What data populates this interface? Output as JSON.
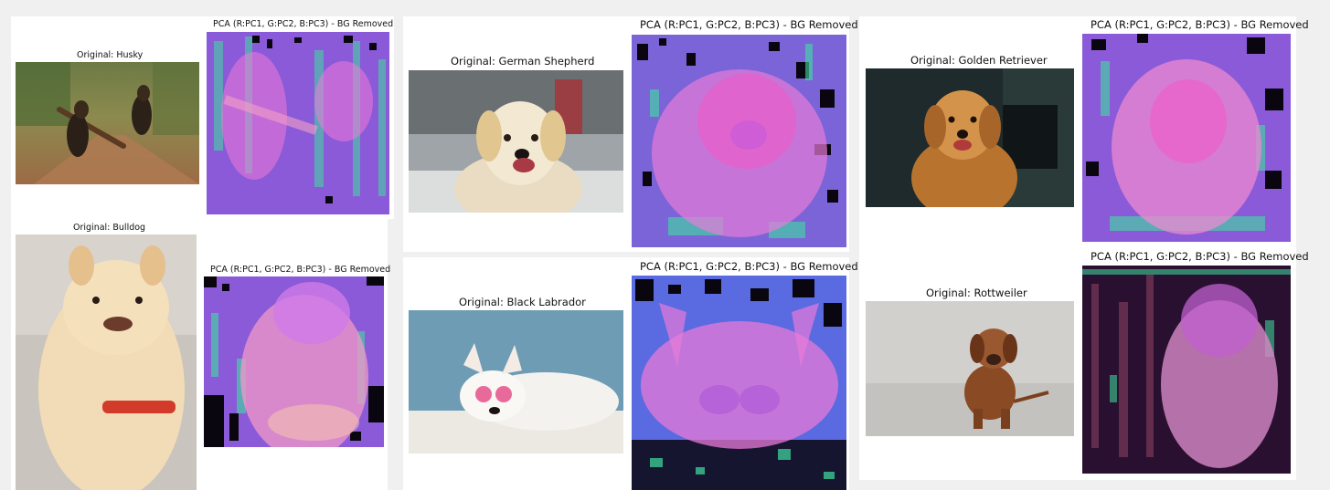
{
  "figures": [
    {
      "original_title": "Original: Husky",
      "pca_title": "PCA (R:PC1, G:PC2, B:PC3) - BG Removed"
    },
    {
      "original_title": "Original: Bulldog",
      "pca_title": "PCA (R:PC1, G:PC2, B:PC3) - BG Removed"
    },
    {
      "original_title": "Original: German Shepherd",
      "pca_title": "PCA (R:PC1, G:PC2, B:PC3) - BG Removed"
    },
    {
      "original_title": "Original: Black Labrador",
      "pca_title": "PCA (R:PC1, G:PC2, B:PC3) - BG Removed"
    },
    {
      "original_title": "Original: Golden Retriever",
      "pca_title": "PCA (R:PC1, G:PC2, B:PC3) - BG Removed"
    },
    {
      "original_title": "Original: Rottweiler",
      "pca_title": "PCA (R:PC1, G:PC2, B:PC3) - BG Removed"
    }
  ],
  "colors": {
    "page_bg": "#f0f0f0",
    "panel_bg": "#ffffff",
    "pca_purple": "#8a5ad8",
    "pca_pink": "#f07ad8",
    "pca_green": "#3ee0a0",
    "pca_black": "#0a0610"
  }
}
